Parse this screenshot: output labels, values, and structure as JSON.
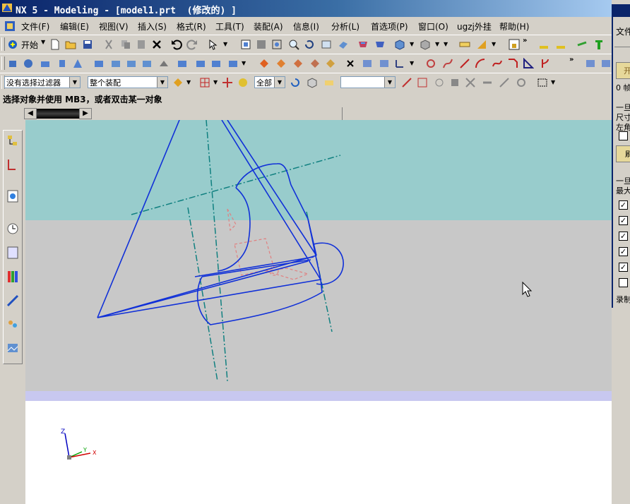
{
  "window": {
    "title": "NX 5 - Modeling - [model1.prt  (修改的) ]"
  },
  "menu": [
    "文件(F)",
    "编辑(E)",
    "视图(V)",
    "插入(S)",
    "格式(R)",
    "工具(T)",
    "装配(A)",
    "信息(I)",
    "分析(L)",
    "首选项(P)",
    "窗口(O)",
    "ugzj外挂",
    "帮助(H)"
  ],
  "toolbar": {
    "start_label": "开始"
  },
  "selection": {
    "filter_value": "没有选择过滤器",
    "scope_value": "整个装配",
    "all_value": "全部",
    "empty_value": ""
  },
  "status": {
    "prompt": "选择对象并使用 MB3，或者双击某一对象"
  },
  "triad": {
    "z": "Z",
    "y": "Y",
    "x": "X"
  },
  "side_panel": {
    "title": "文件",
    "btn1": "开",
    "zero_text": "0 帧",
    "sec1_label": "一旦",
    "size_label": "尺寸",
    "corner_label": "左角",
    "refresh": "刷",
    "sec2_label": "一旦",
    "max_label": "最大",
    "record_label": "录制",
    "checkboxes": [
      false,
      true,
      true,
      true,
      true,
      true,
      false
    ]
  },
  "colors": {
    "title_start": "#0a246a",
    "viewport_top": "#98cccc",
    "viewport_mid": "#c8c8c8",
    "band": "#c8c8f0",
    "geometry": "#1030d8",
    "centerline": "#108080",
    "hidden": "#e08080"
  }
}
